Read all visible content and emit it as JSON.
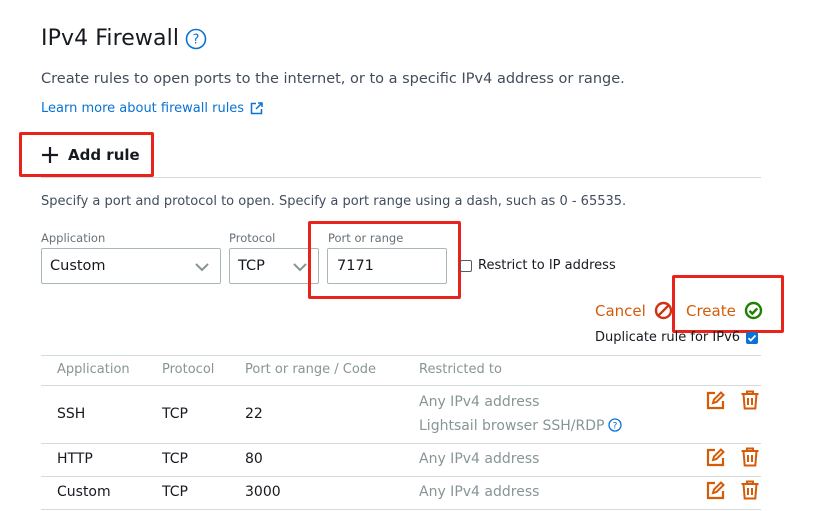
{
  "header": {
    "title": "IPv4 Firewall",
    "description": "Create rules to open ports to the internet, or to a specific IPv4 address or range.",
    "learn_more": "Learn more about firewall rules"
  },
  "add_rule": {
    "label": "Add rule",
    "hint": "Specify a port and protocol to open. Specify a port range using a dash, such as 0 - 65535."
  },
  "form": {
    "application_label": "Application",
    "application_value": "Custom",
    "protocol_label": "Protocol",
    "protocol_value": "TCP",
    "port_label": "Port or range",
    "port_value": "7171",
    "restrict_label": "Restrict to IP address",
    "restrict_checked": false,
    "cancel_label": "Cancel",
    "create_label": "Create",
    "duplicate_label": "Duplicate rule for IPv6",
    "duplicate_checked": true
  },
  "table": {
    "headers": [
      "Application",
      "Protocol",
      "Port or range / Code",
      "Restricted to"
    ],
    "rows": [
      {
        "application": "SSH",
        "protocol": "TCP",
        "port": "22",
        "restricted": "Any IPv4 address",
        "extra": "Lightsail browser SSH/RDP"
      },
      {
        "application": "HTTP",
        "protocol": "TCP",
        "port": "80",
        "restricted": "Any IPv4 address"
      },
      {
        "application": "Custom",
        "protocol": "TCP",
        "port": "3000",
        "restricted": "Any IPv4 address"
      }
    ]
  },
  "colors": {
    "accent_orange": "#d45b07",
    "link_blue": "#0972d3",
    "success_green": "#1d8102",
    "cancel_red": "#d13212",
    "highlight_red": "#e8231b"
  },
  "icons": [
    "help-icon",
    "external-link-icon",
    "plus-icon",
    "chevron-down-icon",
    "cancel-icon",
    "check-circle-icon",
    "edit-icon",
    "trash-icon"
  ]
}
